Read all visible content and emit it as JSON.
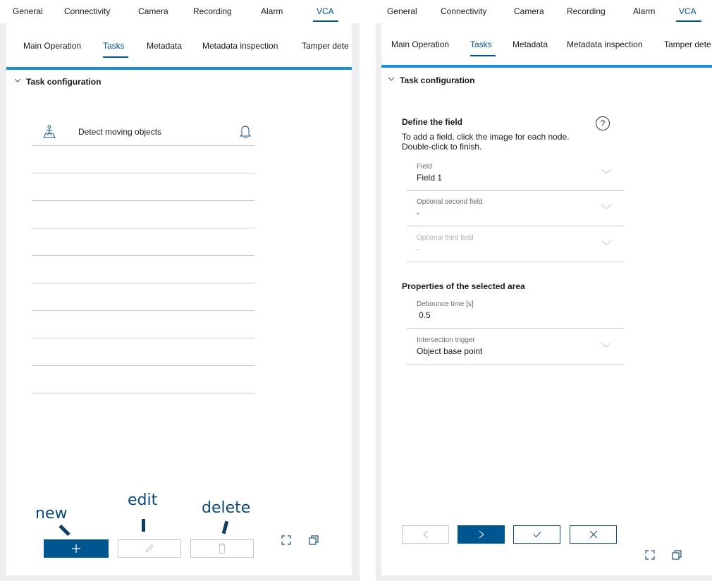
{
  "left": {
    "top_tabs": [
      {
        "label": "General"
      },
      {
        "label": "Connectivity"
      },
      {
        "label": "Camera"
      },
      {
        "label": "Recording"
      },
      {
        "label": "Alarm"
      },
      {
        "label": "VCA"
      }
    ],
    "sub_tabs": [
      {
        "label": "Main Operation"
      },
      {
        "label": "Tasks"
      },
      {
        "label": "Metadata"
      },
      {
        "label": "Metadata inspection"
      },
      {
        "label": "Tamper dete"
      }
    ],
    "section_title": "Task configuration",
    "tasks": [
      {
        "label": "Detect moving objects",
        "icon": "person-in-field-icon",
        "alarm_icon": "bell-icon"
      }
    ],
    "annotations": {
      "new": "new",
      "edit": "edit",
      "delete": "delete"
    },
    "buttons": {
      "new_icon": "plus-icon",
      "edit_icon": "pencil-icon",
      "delete_icon": "trash-icon"
    }
  },
  "right": {
    "top_tabs": [
      {
        "label": "General"
      },
      {
        "label": "Connectivity"
      },
      {
        "label": "Camera"
      },
      {
        "label": "Recording"
      },
      {
        "label": "Alarm"
      },
      {
        "label": "VCA"
      }
    ],
    "sub_tabs": [
      {
        "label": "Main Operation"
      },
      {
        "label": "Tasks"
      },
      {
        "label": "Metadata"
      },
      {
        "label": "Metadata inspection"
      },
      {
        "label": "Tamper dete"
      }
    ],
    "section_title": "Task configuration",
    "define_title": "Define the field",
    "define_help_line1": "To add a field, click the image for each node.",
    "define_help_line2": "Double-click to finish.",
    "fields": [
      {
        "label": "Field",
        "value": "Field 1",
        "disabled": false
      },
      {
        "label": "Optional second field",
        "value": "-",
        "disabled": false
      },
      {
        "label": "Optional third field",
        "value": "-",
        "disabled": true
      }
    ],
    "properties_title": "Properties of the selected area",
    "debounce": {
      "label": "Debounce time [s]",
      "value": "0.5"
    },
    "intersection": {
      "label": "Intersection trigger",
      "value": "Object base point"
    }
  },
  "colors": {
    "accent": "#005691",
    "highlight_bar": "#1a8fd5",
    "frame": "#eeeeee"
  }
}
